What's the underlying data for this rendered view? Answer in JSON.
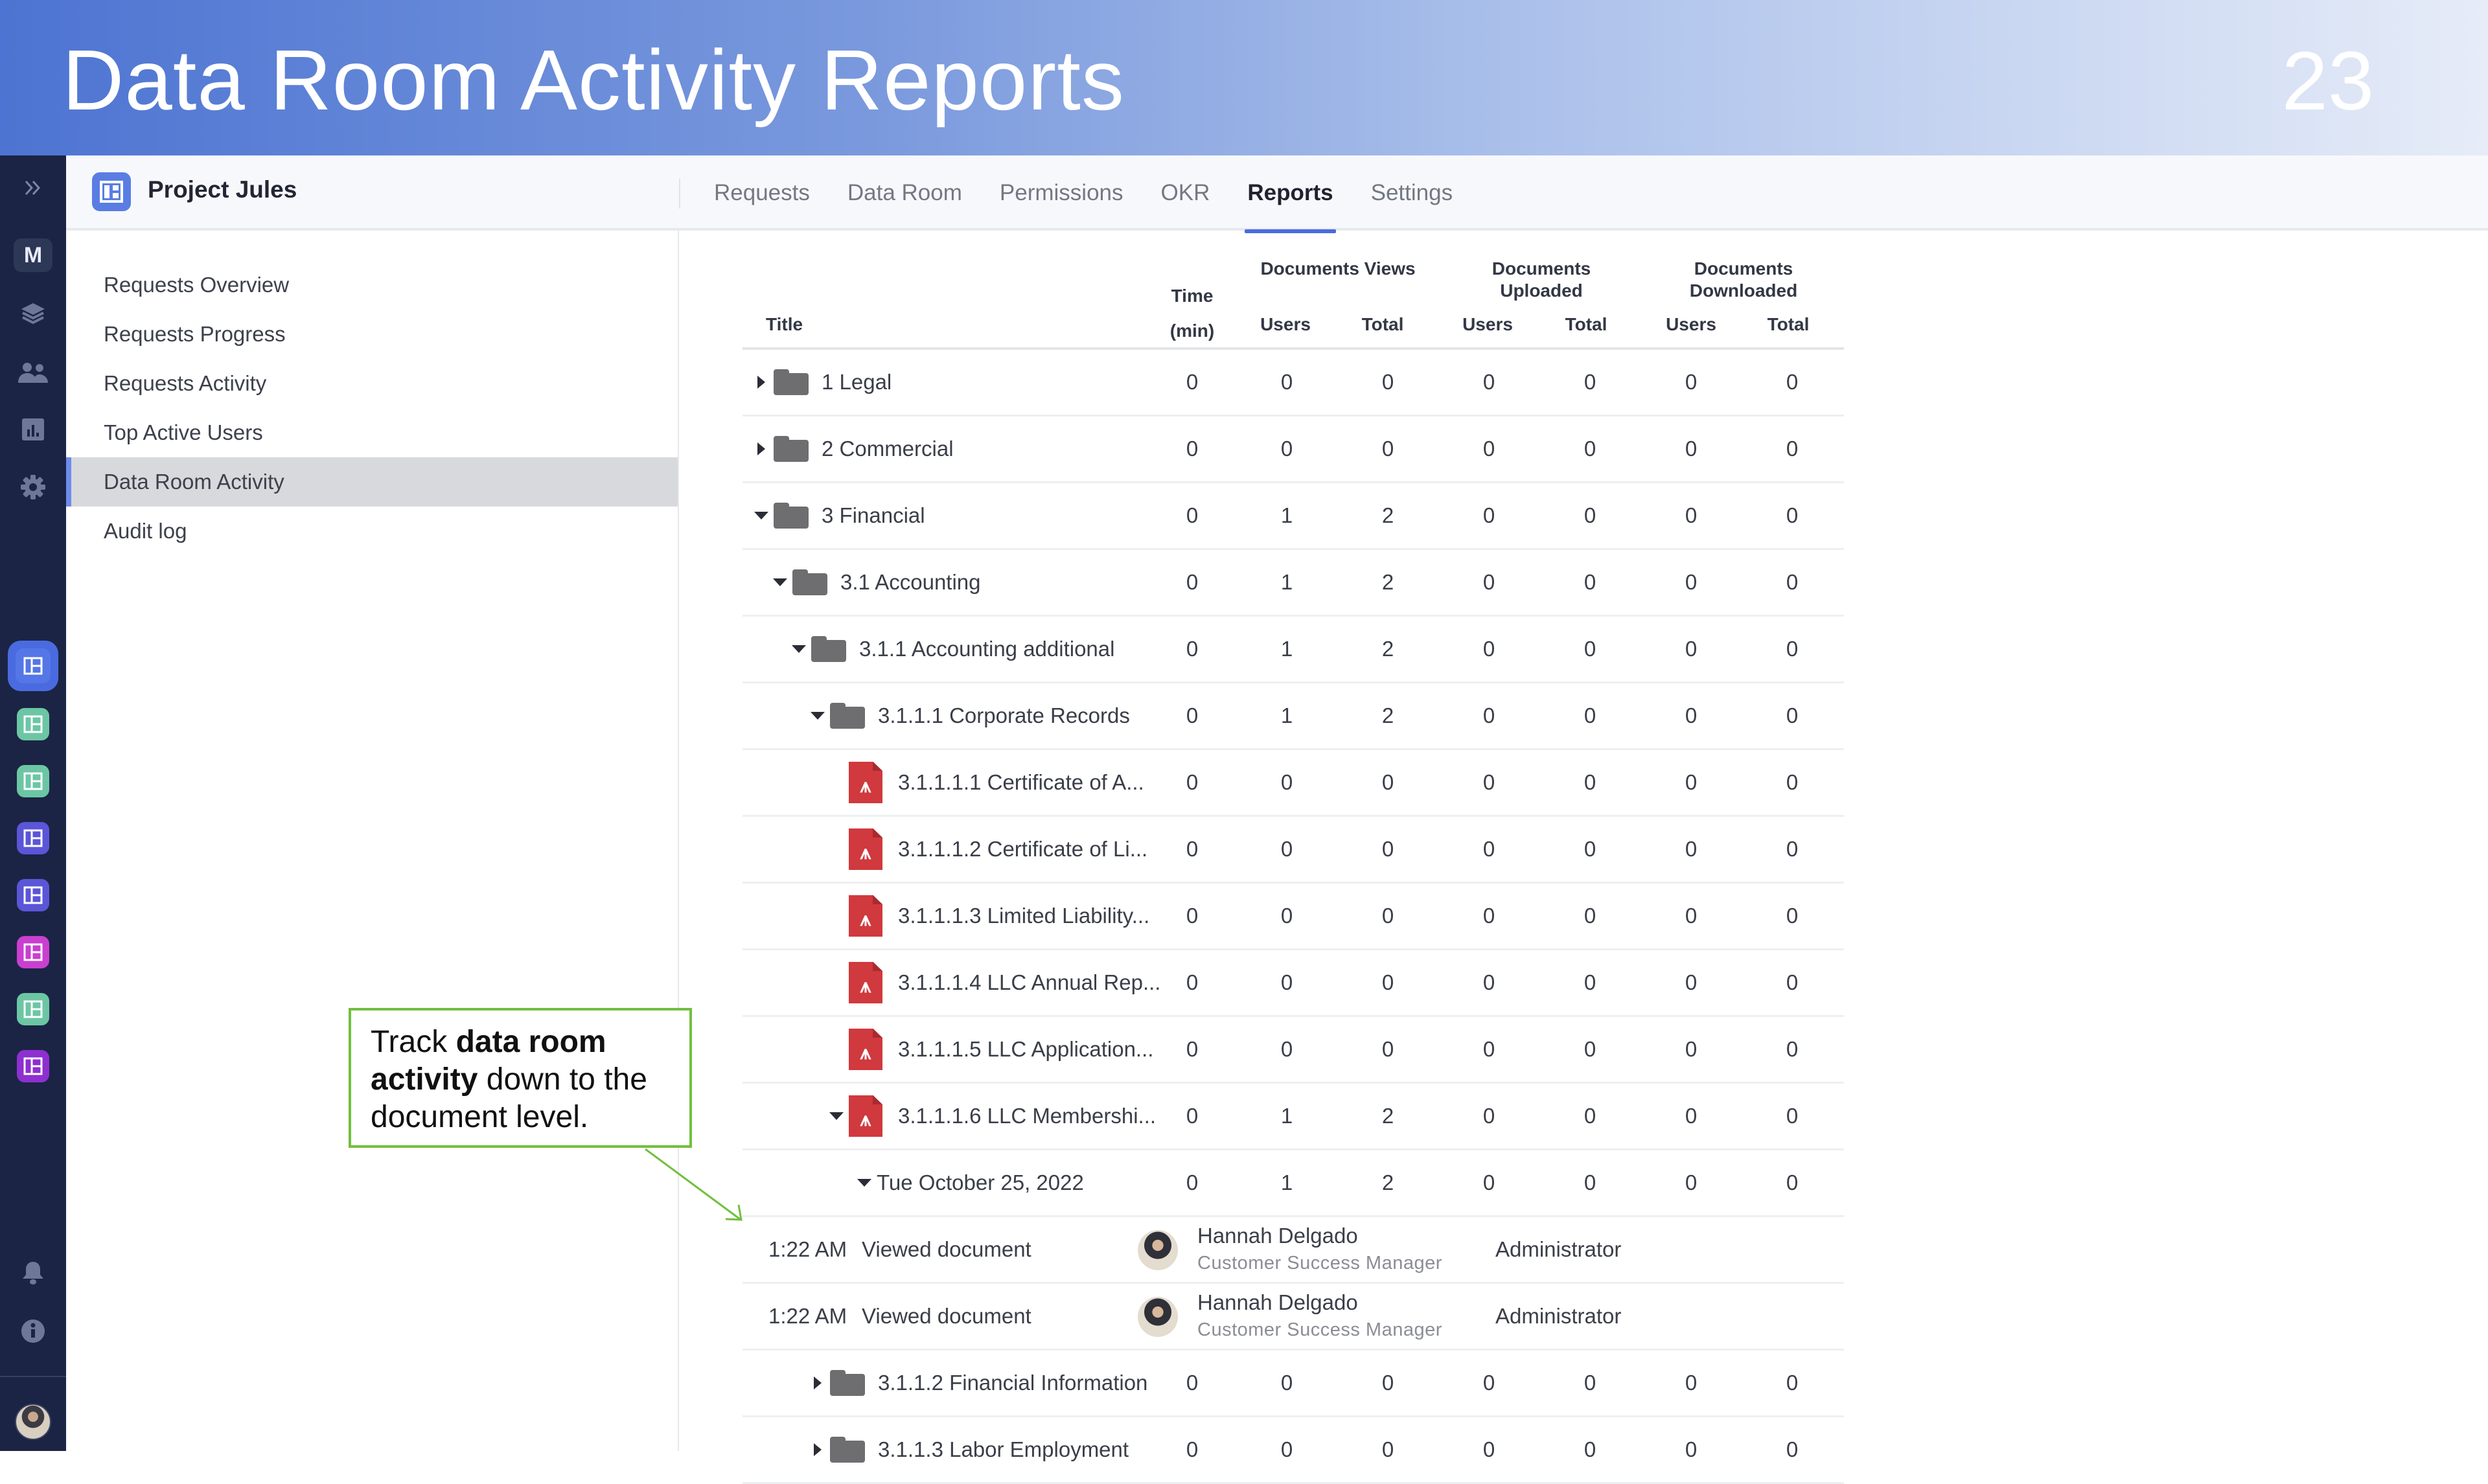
{
  "slide": {
    "title": "Data Room Activity Reports",
    "page_number": "23"
  },
  "rail": {
    "workspace_initial": "M",
    "icons": [
      "expand-icon",
      "layers-icon",
      "users-icon",
      "chart-icon",
      "gear-icon"
    ],
    "apps": [
      {
        "color": "#4a6be0",
        "active": true
      },
      {
        "color": "#6cc6a4"
      },
      {
        "color": "#6cc6a4"
      },
      {
        "color": "#5b55d8"
      },
      {
        "color": "#5b55d8"
      },
      {
        "color": "#c93fd0"
      },
      {
        "color": "#6cc6a4"
      },
      {
        "color": "#8e2fd0"
      }
    ],
    "bottom_icons": [
      "bell-icon",
      "info-icon"
    ]
  },
  "topbar": {
    "project_name": "Project Jules",
    "tabs": [
      {
        "label": "Requests"
      },
      {
        "label": "Data Room"
      },
      {
        "label": "Permissions"
      },
      {
        "label": "OKR"
      },
      {
        "label": "Reports",
        "active": true
      },
      {
        "label": "Settings"
      }
    ]
  },
  "sidebar": {
    "items": [
      {
        "label": "Requests Overview"
      },
      {
        "label": "Requests Progress"
      },
      {
        "label": "Requests Activity"
      },
      {
        "label": "Top Active Users"
      },
      {
        "label": "Data Room Activity",
        "active": true
      },
      {
        "label": "Audit log"
      }
    ]
  },
  "table": {
    "headers": {
      "title": "Title",
      "time_top": "Time",
      "time_bottom": "(min)",
      "views": "Documents Views",
      "uploaded": "Documents Uploaded",
      "downloaded": "Documents Downloaded",
      "users": "Users",
      "total": "Total"
    },
    "rows": [
      {
        "type": "folder",
        "caret": "right",
        "level": 0,
        "title": "1 Legal",
        "values": [
          "0",
          "0",
          "0",
          "0",
          "0",
          "0",
          "0"
        ]
      },
      {
        "type": "folder",
        "caret": "right",
        "level": 0,
        "title": "2 Commercial",
        "values": [
          "0",
          "0",
          "0",
          "0",
          "0",
          "0",
          "0"
        ]
      },
      {
        "type": "folder",
        "caret": "down",
        "level": 0,
        "title": "3 Financial",
        "values": [
          "0",
          "1",
          "2",
          "0",
          "0",
          "0",
          "0"
        ]
      },
      {
        "type": "folder",
        "caret": "down",
        "level": 1,
        "title": "3.1 Accounting",
        "values": [
          "0",
          "1",
          "2",
          "0",
          "0",
          "0",
          "0"
        ]
      },
      {
        "type": "folder",
        "caret": "down",
        "level": 2,
        "title": "3.1.1 Accounting additional",
        "values": [
          "0",
          "1",
          "2",
          "0",
          "0",
          "0",
          "0"
        ]
      },
      {
        "type": "folder",
        "caret": "down",
        "level": 3,
        "title": "3.1.1.1 Corporate Records",
        "values": [
          "0",
          "1",
          "2",
          "0",
          "0",
          "0",
          "0"
        ]
      },
      {
        "type": "pdf",
        "caret": "none",
        "level": 4,
        "title": "3.1.1.1.1 Certificate of A...",
        "values": [
          "0",
          "0",
          "0",
          "0",
          "0",
          "0",
          "0"
        ]
      },
      {
        "type": "pdf",
        "caret": "none",
        "level": 4,
        "title": "3.1.1.1.2 Certificate of Li...",
        "values": [
          "0",
          "0",
          "0",
          "0",
          "0",
          "0",
          "0"
        ]
      },
      {
        "type": "pdf",
        "caret": "none",
        "level": 4,
        "title": "3.1.1.1.3 Limited Liability...",
        "values": [
          "0",
          "0",
          "0",
          "0",
          "0",
          "0",
          "0"
        ]
      },
      {
        "type": "pdf",
        "caret": "none",
        "level": 4,
        "title": "3.1.1.1.4 LLC Annual Rep...",
        "values": [
          "0",
          "0",
          "0",
          "0",
          "0",
          "0",
          "0"
        ]
      },
      {
        "type": "pdf",
        "caret": "none",
        "level": 4,
        "title": "3.1.1.1.5 LLC Application...",
        "values": [
          "0",
          "0",
          "0",
          "0",
          "0",
          "0",
          "0"
        ]
      },
      {
        "type": "pdf",
        "caret": "down",
        "level": 4,
        "title": "3.1.1.1.6 LLC Membershi...",
        "values": [
          "0",
          "1",
          "2",
          "0",
          "0",
          "0",
          "0"
        ]
      },
      {
        "type": "date",
        "caret": "down",
        "level": 5,
        "title": "Tue October 25, 2022",
        "values": [
          "0",
          "1",
          "2",
          "0",
          "0",
          "0",
          "0"
        ]
      },
      {
        "type": "event",
        "time": "1:22 AM",
        "action": "Viewed document",
        "user": "Hannah Delgado",
        "job": "Customer Success Manager",
        "role": "Administrator"
      },
      {
        "type": "event",
        "time": "1:22 AM",
        "action": "Viewed document",
        "user": "Hannah Delgado",
        "job": "Customer Success Manager",
        "role": "Administrator"
      },
      {
        "type": "folder",
        "caret": "right",
        "level": 3,
        "title": "3.1.1.2 Financial Information",
        "values": [
          "0",
          "0",
          "0",
          "0",
          "0",
          "0",
          "0"
        ]
      },
      {
        "type": "folder",
        "caret": "right",
        "level": 3,
        "title": "3.1.1.3 Labor   Employment",
        "values": [
          "0",
          "0",
          "0",
          "0",
          "0",
          "0",
          "0"
        ]
      }
    ]
  },
  "callout": {
    "pre": "Track ",
    "bold": "data room activity",
    "post": " down to the document level.",
    "color": "#72bf3e"
  }
}
